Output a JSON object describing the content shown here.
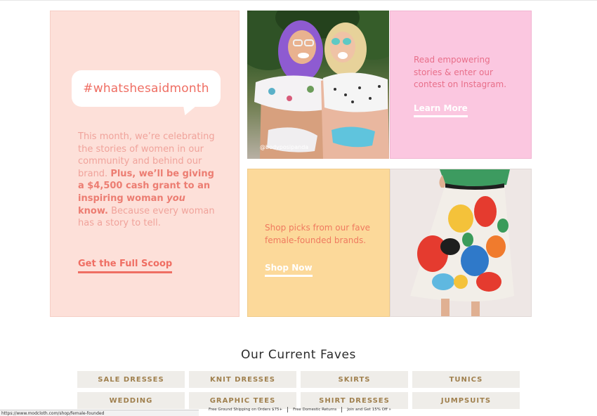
{
  "hero": {
    "hashtag": "#whatshesaidmonth",
    "body_intro": "This month, we’re celebrating the stories of women in our community and behind our brand.",
    "body_bold_1": "Plus, we’ll be giving a $4,500 cash grant to an inspiring woman",
    "body_bold_em": "you",
    "body_bold_2": "know.",
    "body_outro": "Because every woman has a story to tell.",
    "cta": "Get the Full Scoop"
  },
  "instagram_photo": {
    "caption": "@bodyposipanda"
  },
  "instagram_tile": {
    "text": "Read empowering stories & enter our contest on Instagram.",
    "cta": "Learn More"
  },
  "brands_tile": {
    "text": "Shop picks from our fave female-founded brands.",
    "cta": "Shop Now"
  },
  "faves": {
    "title": "Our Current Faves",
    "categories": [
      "SALE DRESSES",
      "KNIT DRESSES",
      "SKIRTS",
      "TUNICS",
      "WEDDING",
      "GRAPHIC TEES",
      "SHIRT DRESSES",
      "JUMPSUITS"
    ]
  },
  "status_bar": {
    "url": "https://www.modcloth.com/shop/female-founded"
  },
  "promo_bar": {
    "items": [
      "Free Ground Shipping on Orders $75+",
      "Free Domestic Returns",
      "Join and Get 15% Off »"
    ]
  },
  "colors": {
    "coral": "#ef6e63",
    "blush": "#fde0d9",
    "pink": "#fbc7e0",
    "yellow": "#fcd99a",
    "gold_text": "#a0804e"
  }
}
